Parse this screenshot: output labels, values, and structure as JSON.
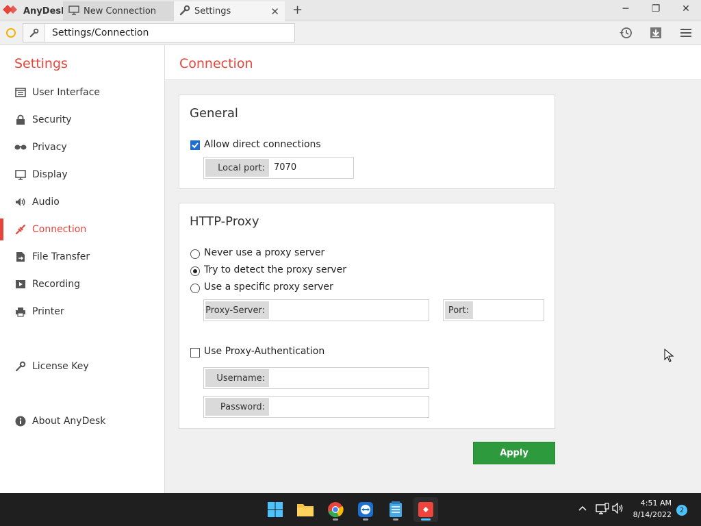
{
  "app": {
    "brand": "AnyDesk",
    "accent_color": "#e5453b",
    "tabs": [
      {
        "label": "New Connection",
        "icon": "monitor-icon"
      },
      {
        "label": "Settings",
        "icon": "wrench-icon"
      }
    ]
  },
  "address_bar": {
    "value": "Settings/Connection"
  },
  "sidebar": {
    "title": "Settings",
    "items": [
      {
        "label": "User Interface",
        "icon": "user-interface-icon"
      },
      {
        "label": "Security",
        "icon": "lock-icon"
      },
      {
        "label": "Privacy",
        "icon": "glasses-icon"
      },
      {
        "label": "Display",
        "icon": "monitor-icon"
      },
      {
        "label": "Audio",
        "icon": "speaker-icon"
      },
      {
        "label": "Connection",
        "icon": "connection-icon",
        "active": true
      },
      {
        "label": "File Transfer",
        "icon": "file-transfer-icon"
      },
      {
        "label": "Recording",
        "icon": "recording-icon"
      },
      {
        "label": "Printer",
        "icon": "printer-icon"
      },
      {
        "label": "License Key",
        "icon": "key-icon"
      },
      {
        "label": "About AnyDesk",
        "icon": "info-icon"
      }
    ]
  },
  "page": {
    "title": "Connection"
  },
  "general": {
    "title": "General",
    "allow_direct_label": "Allow direct connections",
    "allow_direct_checked": true,
    "local_port_label": "Local port:",
    "local_port_value": "7070"
  },
  "proxy": {
    "title": "HTTP-Proxy",
    "options": [
      {
        "label": "Never use a proxy server",
        "selected": false
      },
      {
        "label": "Try to detect the proxy server",
        "selected": true
      },
      {
        "label": "Use a specific proxy server",
        "selected": false
      }
    ],
    "server_label": "Proxy-Server:",
    "port_label": "Port:",
    "auth_label": "Use Proxy-Authentication",
    "auth_checked": false,
    "username_label": "Username:",
    "password_label": "Password:"
  },
  "apply_label": "Apply",
  "taskbar": {
    "apps": [
      "windows-start-icon",
      "file-explorer-icon",
      "chrome-icon",
      "teamviewer-icon",
      "notepad-icon",
      "anydesk-icon"
    ],
    "time": "4:51 AM",
    "date": "8/14/2022",
    "notification_count": "2"
  }
}
